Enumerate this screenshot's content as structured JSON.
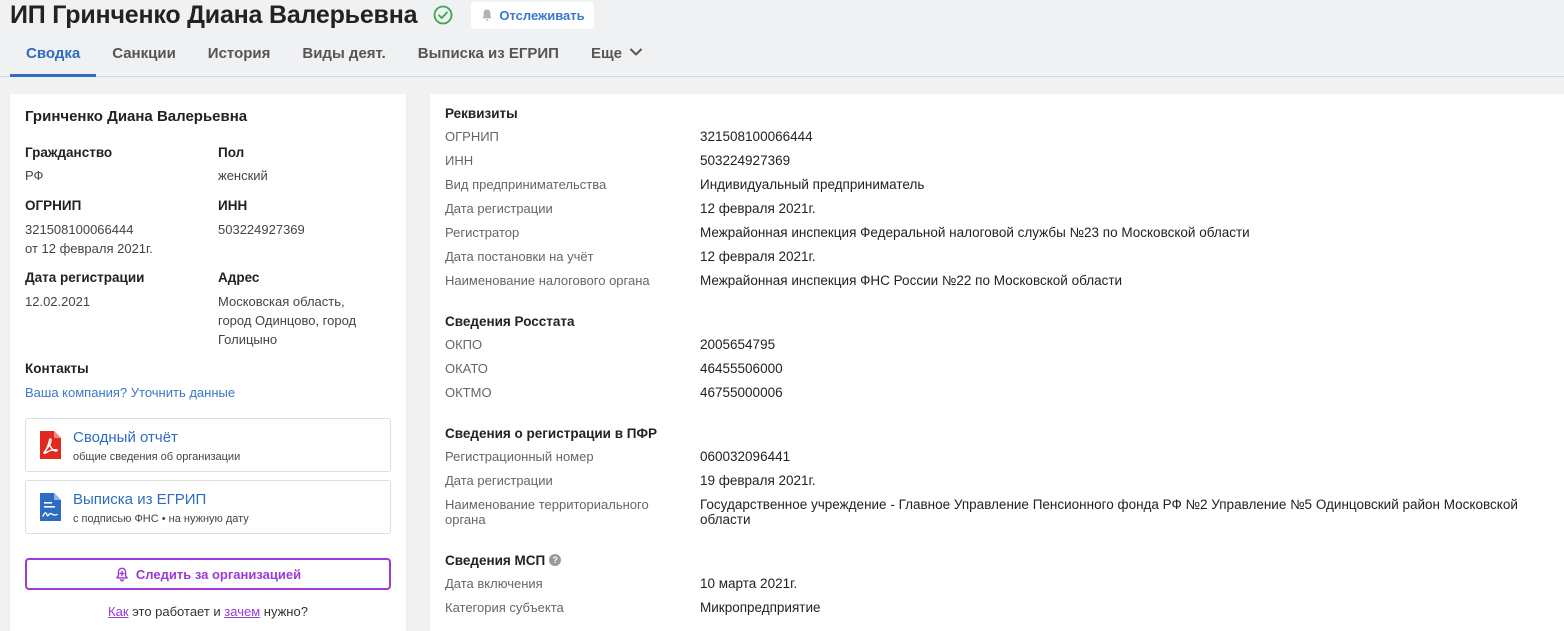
{
  "header": {
    "title": "ИП Гринченко Диана Валерьевна",
    "follow_label": "Отслеживать"
  },
  "tabs": [
    {
      "label": "Сводка"
    },
    {
      "label": "Санкции"
    },
    {
      "label": "История"
    },
    {
      "label": "Виды деят."
    },
    {
      "label": "Выписка из ЕГРИП"
    },
    {
      "label": "Еще"
    }
  ],
  "summary": {
    "name": "Гринченко Диана Валерьевна",
    "citizenship_label": "Гражданство",
    "citizenship": "РФ",
    "gender_label": "Пол",
    "gender": "женский",
    "ogrnip_label": "ОГРНИП",
    "ogrnip": "321508100066444",
    "ogrnip_date": "от 12 февраля 2021г.",
    "inn_label": "ИНН",
    "inn": "503224927369",
    "reg_date_label": "Дата регистрации",
    "reg_date": "12.02.2021",
    "address_label": "Адрес",
    "address_line1": "Московская область,",
    "address_line2": "город Одинцово, город",
    "address_line3": "Голицыно",
    "contacts_label": "Контакты",
    "contacts_link": "Ваша компания? Уточнить данные",
    "doc1_title": "Сводный отчёт",
    "doc1_sub": "общие сведения об организации",
    "doc2_title": "Выписка из ЕГРИП",
    "doc2_sub": "с подписью ФНС • на нужную дату",
    "watch_label": "Следить за организацией",
    "how_link": "Как",
    "how_mid": " это работает и ",
    "why_link": "зачем",
    "how_end": " нужно?"
  },
  "requisites": {
    "title": "Реквизиты",
    "rows": [
      {
        "label": "ОГРНИП",
        "value": "321508100066444"
      },
      {
        "label": "ИНН",
        "value": "503224927369"
      },
      {
        "label": "Вид предпринимательства",
        "value": "Индивидуальный предприниматель"
      },
      {
        "label": "Дата регистрации",
        "value": "12 февраля 2021г."
      },
      {
        "label": "Регистратор",
        "value": "Межрайонная инспекция Федеральной налоговой службы №23 по Московской области"
      },
      {
        "label": "Дата постановки на учёт",
        "value": "12 февраля 2021г."
      },
      {
        "label": "Наименование налогового органа",
        "value": "Межрайонная инспекция ФНС России №22 по Московской области"
      }
    ]
  },
  "rosstat": {
    "title": "Сведения Росстата",
    "rows": [
      {
        "label": "ОКПО",
        "value": "2005654795"
      },
      {
        "label": "ОКАТО",
        "value": "46455506000"
      },
      {
        "label": "ОКТМО",
        "value": "46755000006"
      }
    ]
  },
  "pfr": {
    "title": "Сведения о регистрации в ПФР",
    "rows": [
      {
        "label": "Регистрационный номер",
        "value": "060032096441"
      },
      {
        "label": "Дата регистрации",
        "value": "19 февраля 2021г."
      },
      {
        "label": "Наименование территориального органа",
        "value": "Государственное учреждение - Главное Управление Пенсионного фонда РФ №2 Управление №5 Одинцовский район Московской области"
      }
    ]
  },
  "msp": {
    "title": "Сведения МСП",
    "help": "?",
    "rows": [
      {
        "label": "Дата включения",
        "value": "10 марта 2021г."
      },
      {
        "label": "Категория субъекта",
        "value": "Микропредприятие"
      }
    ]
  }
}
